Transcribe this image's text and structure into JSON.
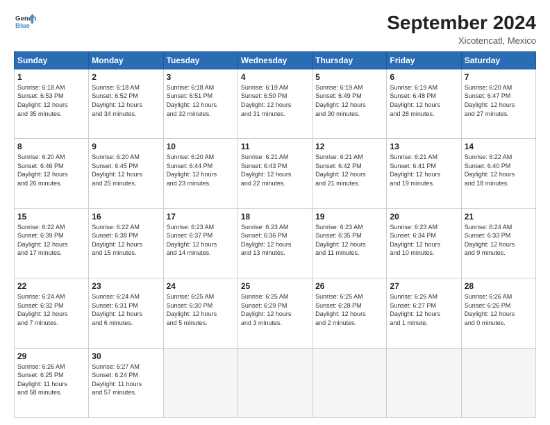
{
  "logo": {
    "line1": "General",
    "line2": "Blue"
  },
  "title": "September 2024",
  "subtitle": "Xicotencatl, Mexico",
  "days_of_week": [
    "Sunday",
    "Monday",
    "Tuesday",
    "Wednesday",
    "Thursday",
    "Friday",
    "Saturday"
  ],
  "weeks": [
    [
      {
        "day": 1,
        "info": "Sunrise: 6:18 AM\nSunset: 6:53 PM\nDaylight: 12 hours\nand 35 minutes."
      },
      {
        "day": 2,
        "info": "Sunrise: 6:18 AM\nSunset: 6:52 PM\nDaylight: 12 hours\nand 34 minutes."
      },
      {
        "day": 3,
        "info": "Sunrise: 6:18 AM\nSunset: 6:51 PM\nDaylight: 12 hours\nand 32 minutes."
      },
      {
        "day": 4,
        "info": "Sunrise: 6:19 AM\nSunset: 6:50 PM\nDaylight: 12 hours\nand 31 minutes."
      },
      {
        "day": 5,
        "info": "Sunrise: 6:19 AM\nSunset: 6:49 PM\nDaylight: 12 hours\nand 30 minutes."
      },
      {
        "day": 6,
        "info": "Sunrise: 6:19 AM\nSunset: 6:48 PM\nDaylight: 12 hours\nand 28 minutes."
      },
      {
        "day": 7,
        "info": "Sunrise: 6:20 AM\nSunset: 6:47 PM\nDaylight: 12 hours\nand 27 minutes."
      }
    ],
    [
      {
        "day": 8,
        "info": "Sunrise: 6:20 AM\nSunset: 6:46 PM\nDaylight: 12 hours\nand 26 minutes."
      },
      {
        "day": 9,
        "info": "Sunrise: 6:20 AM\nSunset: 6:45 PM\nDaylight: 12 hours\nand 25 minutes."
      },
      {
        "day": 10,
        "info": "Sunrise: 6:20 AM\nSunset: 6:44 PM\nDaylight: 12 hours\nand 23 minutes."
      },
      {
        "day": 11,
        "info": "Sunrise: 6:21 AM\nSunset: 6:43 PM\nDaylight: 12 hours\nand 22 minutes."
      },
      {
        "day": 12,
        "info": "Sunrise: 6:21 AM\nSunset: 6:42 PM\nDaylight: 12 hours\nand 21 minutes."
      },
      {
        "day": 13,
        "info": "Sunrise: 6:21 AM\nSunset: 6:41 PM\nDaylight: 12 hours\nand 19 minutes."
      },
      {
        "day": 14,
        "info": "Sunrise: 6:22 AM\nSunset: 6:40 PM\nDaylight: 12 hours\nand 18 minutes."
      }
    ],
    [
      {
        "day": 15,
        "info": "Sunrise: 6:22 AM\nSunset: 6:39 PM\nDaylight: 12 hours\nand 17 minutes."
      },
      {
        "day": 16,
        "info": "Sunrise: 6:22 AM\nSunset: 6:38 PM\nDaylight: 12 hours\nand 15 minutes."
      },
      {
        "day": 17,
        "info": "Sunrise: 6:23 AM\nSunset: 6:37 PM\nDaylight: 12 hours\nand 14 minutes."
      },
      {
        "day": 18,
        "info": "Sunrise: 6:23 AM\nSunset: 6:36 PM\nDaylight: 12 hours\nand 13 minutes."
      },
      {
        "day": 19,
        "info": "Sunrise: 6:23 AM\nSunset: 6:35 PM\nDaylight: 12 hours\nand 11 minutes."
      },
      {
        "day": 20,
        "info": "Sunrise: 6:23 AM\nSunset: 6:34 PM\nDaylight: 12 hours\nand 10 minutes."
      },
      {
        "day": 21,
        "info": "Sunrise: 6:24 AM\nSunset: 6:33 PM\nDaylight: 12 hours\nand 9 minutes."
      }
    ],
    [
      {
        "day": 22,
        "info": "Sunrise: 6:24 AM\nSunset: 6:32 PM\nDaylight: 12 hours\nand 7 minutes."
      },
      {
        "day": 23,
        "info": "Sunrise: 6:24 AM\nSunset: 6:31 PM\nDaylight: 12 hours\nand 6 minutes."
      },
      {
        "day": 24,
        "info": "Sunrise: 6:25 AM\nSunset: 6:30 PM\nDaylight: 12 hours\nand 5 minutes."
      },
      {
        "day": 25,
        "info": "Sunrise: 6:25 AM\nSunset: 6:29 PM\nDaylight: 12 hours\nand 3 minutes."
      },
      {
        "day": 26,
        "info": "Sunrise: 6:25 AM\nSunset: 6:28 PM\nDaylight: 12 hours\nand 2 minutes."
      },
      {
        "day": 27,
        "info": "Sunrise: 6:26 AM\nSunset: 6:27 PM\nDaylight: 12 hours\nand 1 minute."
      },
      {
        "day": 28,
        "info": "Sunrise: 6:26 AM\nSunset: 6:26 PM\nDaylight: 12 hours\nand 0 minutes."
      }
    ],
    [
      {
        "day": 29,
        "info": "Sunrise: 6:26 AM\nSunset: 6:25 PM\nDaylight: 11 hours\nand 58 minutes."
      },
      {
        "day": 30,
        "info": "Sunrise: 6:27 AM\nSunset: 6:24 PM\nDaylight: 11 hours\nand 57 minutes."
      },
      {
        "day": null,
        "info": ""
      },
      {
        "day": null,
        "info": ""
      },
      {
        "day": null,
        "info": ""
      },
      {
        "day": null,
        "info": ""
      },
      {
        "day": null,
        "info": ""
      }
    ]
  ]
}
